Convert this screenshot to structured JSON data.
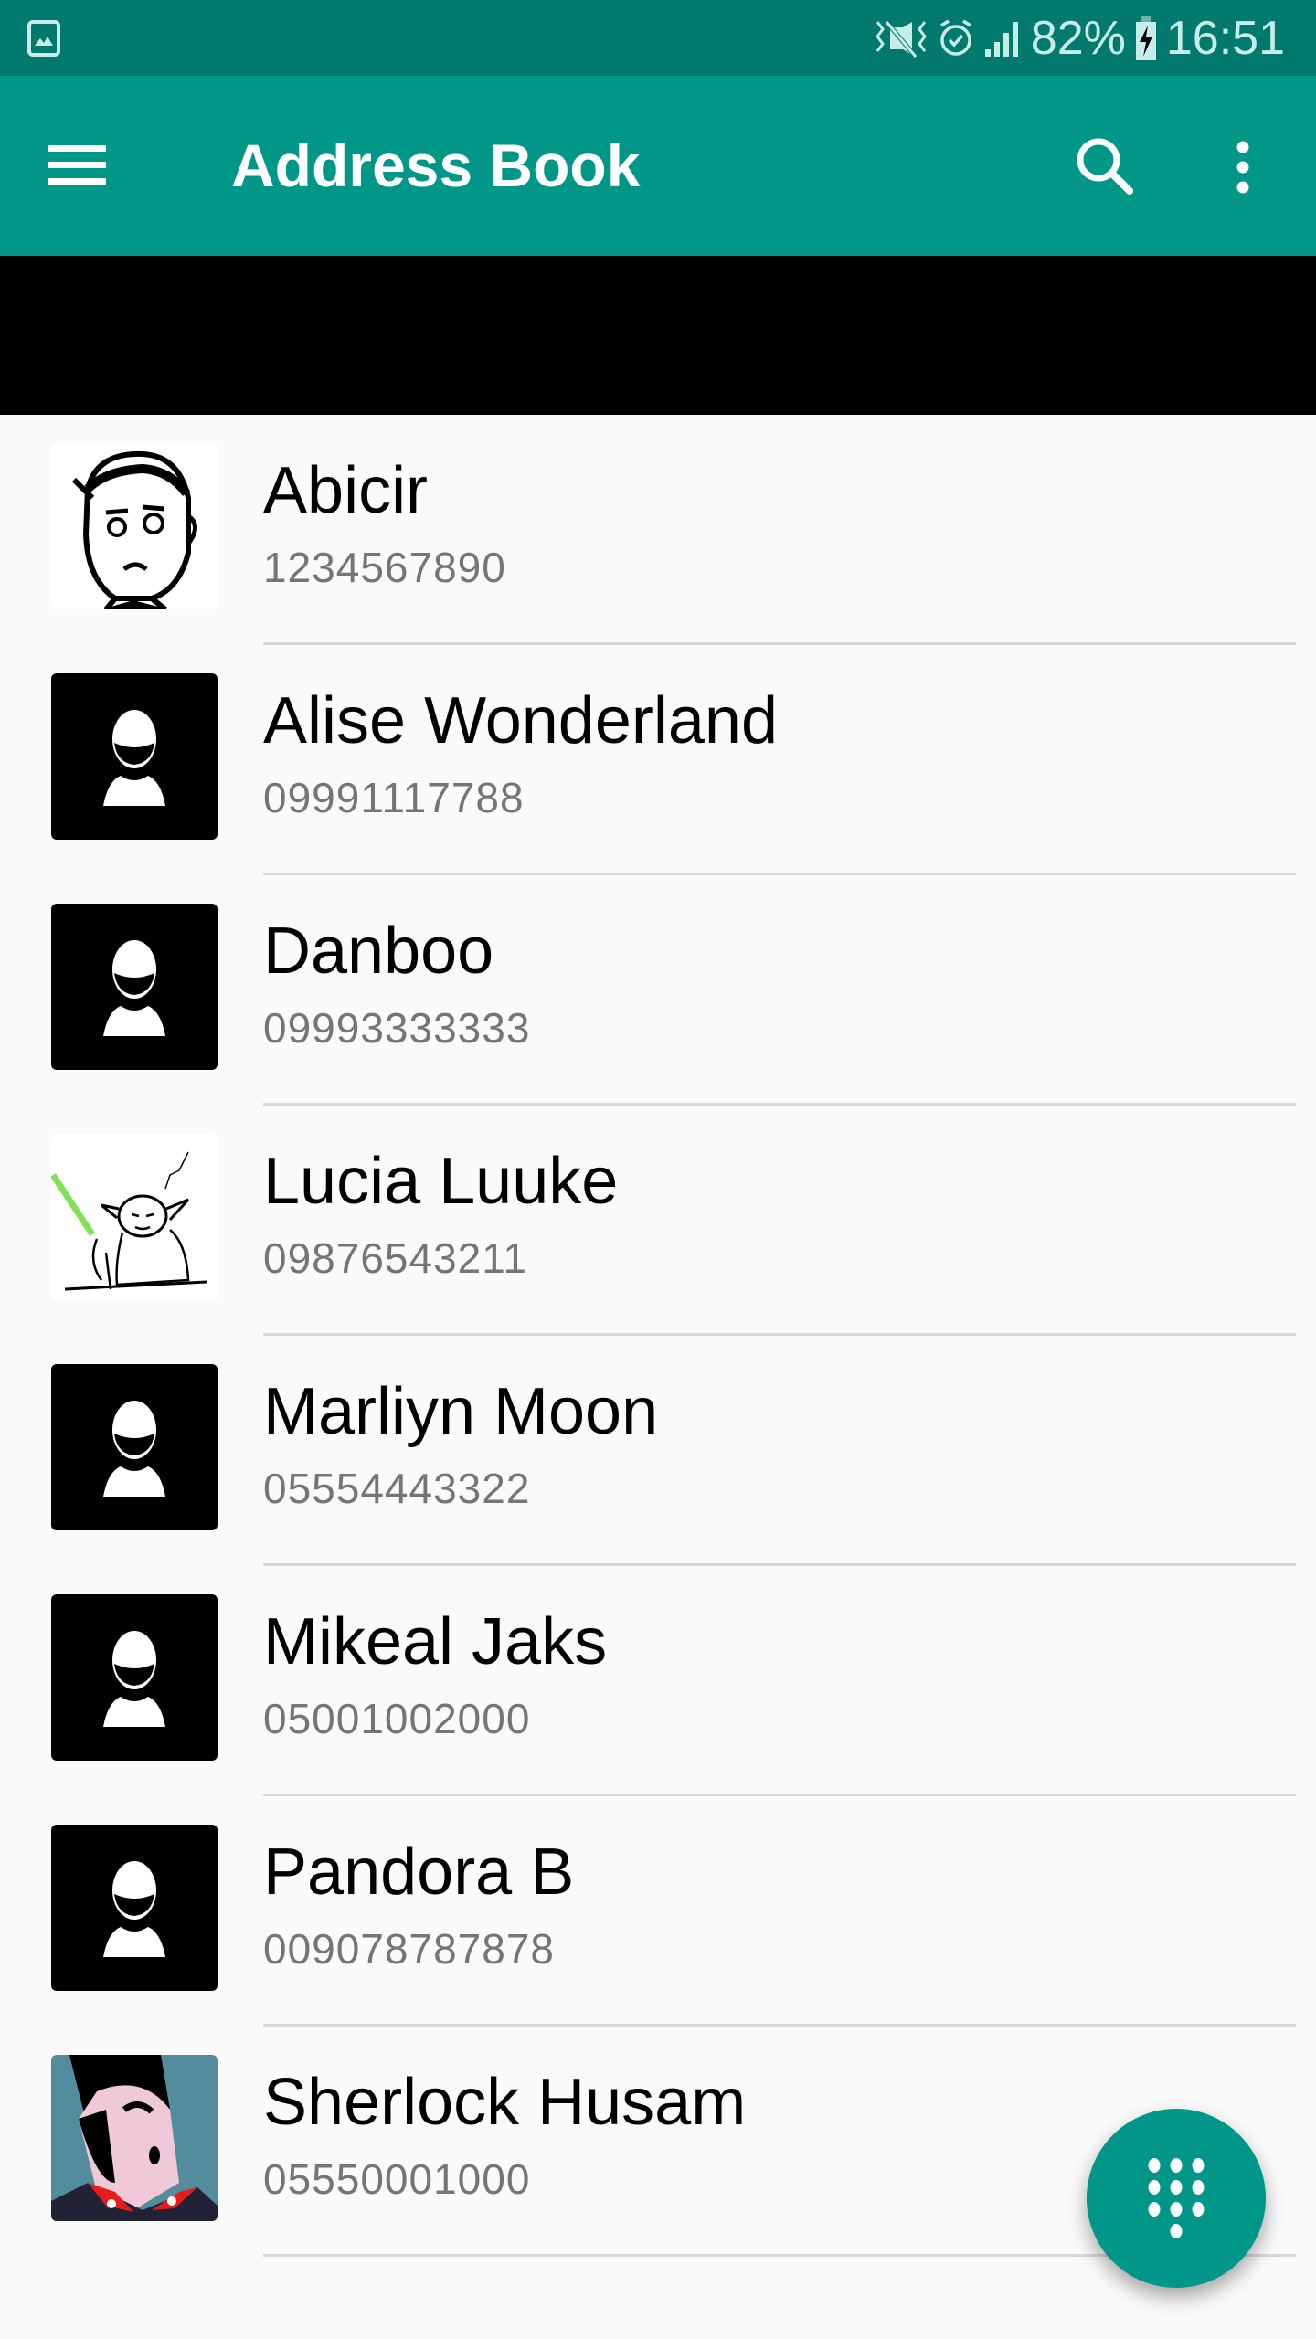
{
  "status_bar": {
    "notification_icon": "image-gallery-icon",
    "icons": [
      "vibrate-mute-icon",
      "alarm-icon",
      "signal-icon",
      "battery-charging-icon"
    ],
    "battery": "82%",
    "time": "16:51"
  },
  "app_bar": {
    "menu_icon": "hamburger-menu-icon",
    "title": "Address Book",
    "search_icon": "search-icon",
    "more_icon": "more-vert-icon"
  },
  "colors": {
    "primary": "#009688",
    "primary_dark": "#01796c",
    "background": "#fafafa",
    "secondary_text": "#757575"
  },
  "contacts": [
    {
      "name": "Abicir",
      "phone": "1234567890",
      "avatar": "sketch-face-photo"
    },
    {
      "name": "Alise Wonderland",
      "phone": "09991117788",
      "avatar": "default-person-icon"
    },
    {
      "name": "Danboo",
      "phone": "09993333333",
      "avatar": "default-person-icon"
    },
    {
      "name": "Lucia Luuke",
      "phone": "09876543211",
      "avatar": "yoda-sketch-photo"
    },
    {
      "name": "Marliyn Moon",
      "phone": "05554443322",
      "avatar": "default-person-icon"
    },
    {
      "name": "Mikeal Jaks",
      "phone": "05001002000",
      "avatar": "default-person-icon"
    },
    {
      "name": "Pandora B",
      "phone": "009078787878",
      "avatar": "default-person-icon"
    },
    {
      "name": "Sherlock Husam",
      "phone": "05550001000",
      "avatar": "cartoon-portrait-photo"
    }
  ],
  "fab": {
    "icon": "dialpad-icon"
  }
}
